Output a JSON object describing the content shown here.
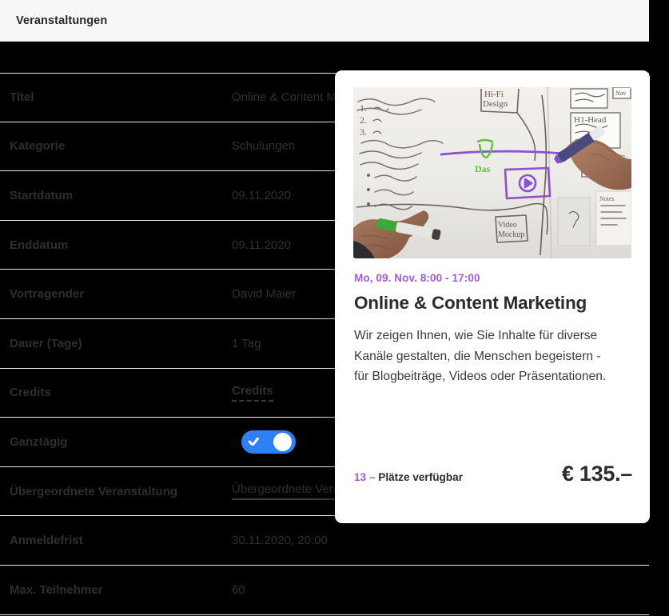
{
  "header": {
    "title": "Veranstaltungen"
  },
  "detail_table": {
    "rows": [
      {
        "label": "Titel",
        "value": "Online & Content Marketing",
        "style": "plain"
      },
      {
        "label": "Kategorie",
        "value": "Schulungen",
        "style": "plain"
      },
      {
        "label": "Startdatum",
        "value": "09.11.2020",
        "style": "plain"
      },
      {
        "label": "Enddatum",
        "value": "09.11.2020",
        "style": "plain"
      },
      {
        "label": "Vortragender",
        "value": "David Maier",
        "style": "plain"
      },
      {
        "label": "Dauer (Tage)",
        "value": "1 Tag",
        "style": "plain"
      },
      {
        "label": "Credits",
        "value": "Credits",
        "style": "underline-dashed"
      },
      {
        "label": "Ganztägig",
        "value": "",
        "style": "toggle"
      },
      {
        "label": "Übergeordnete Veranstaltung",
        "value": "Übergeordnete Veranstaltung",
        "style": "underline-solid"
      },
      {
        "label": "Anmeldefrist",
        "value": "30.11.2020, 20:00",
        "style": "plain"
      },
      {
        "label": "Max. Teilnehmer",
        "value": "60",
        "style": "plain"
      }
    ],
    "toggle": {
      "name": "ganztaegig-toggle",
      "state": "on",
      "on_color": "#2f80f7",
      "knob_color": "#ffffff"
    }
  },
  "event_card": {
    "photo_alt": "whiteboard-sketch-photo",
    "date": "Mo, 09. Nov. 8:00 - 17:00",
    "title": "Online & Content Marketing",
    "description": "Wir zeigen Ihnen, wie Sie Inhalte für diverse Kanäle gestalten, die Menschen begeistern - für Blogbeiträge, Videos oder Präsentationen.",
    "availability_count": "13 –",
    "availability_label": "Plätze verfügbar",
    "price": "€ 135.–"
  },
  "colors": {
    "accent_purple": "#a05bd8",
    "toggle_blue": "#2f80f7",
    "header_bg": "#f7f7f8",
    "overlay_black": "#000000",
    "card_bg": "#ffffff"
  }
}
